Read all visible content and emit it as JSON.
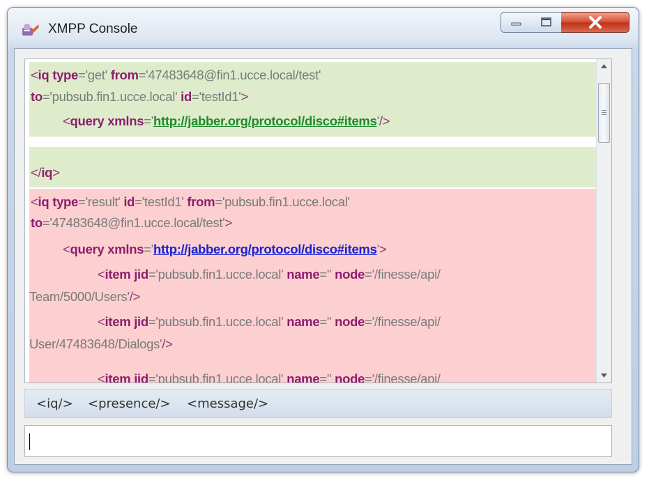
{
  "window": {
    "title": "XMPP Console",
    "app_icon": "xmpp-console-app-icon",
    "controls": {
      "minimize_icon": "minimize-icon",
      "maximize_icon": "maximize-icon",
      "close_icon": "close-icon"
    }
  },
  "colors": {
    "outgoing_bg": "#dfeccb",
    "incoming_bg": "#fcd0d0",
    "tag": "#8b1f6e",
    "attr_value": "#7a7a7a",
    "outgoing_link": "#1f8b2b",
    "incoming_link": "#1a22d6",
    "close_button": "#c0321b"
  },
  "console": {
    "sent": {
      "l1": {
        "lt": "<",
        "tag": "iq",
        "a1": "type",
        "v1": "'get'",
        "a2": "from",
        "v2": "'47483648@fin1.ucce.local/test'"
      },
      "l2": {
        "a1": "to",
        "v1": "'pubsub.fin1.ucce.local'",
        "a2": "id",
        "v2": "'testId1'",
        "gt": ">"
      },
      "l3": {
        "lt": "<",
        "tag": "query",
        "a1": "xmlns",
        "q1": "'",
        "link": "http://jabber.org/protocol/disco#items",
        "q2": "'",
        "end": "/>"
      },
      "l4": {
        "lt": "</",
        "tag": "iq",
        "gt": ">"
      }
    },
    "received": {
      "l1": {
        "lt": "<",
        "tag": "iq",
        "a1": "type",
        "v1": "'result'",
        "a2": "id",
        "v2": "'testId1'",
        "a3": "from",
        "v3": "'pubsub.fin1.ucce.local'"
      },
      "l2": {
        "a1": "to",
        "v1": "'47483648@fin1.ucce.local/test'",
        "gt": ">"
      },
      "l3": {
        "lt": "<",
        "tag": "query",
        "a1": "xmlns",
        "q1": "'",
        "link": "http://jabber.org/protocol/disco#items",
        "q2": "'",
        "gt": ">"
      },
      "item1": {
        "lt": "<",
        "tag": "item",
        "a1": "jid",
        "v1": "'pubsub.fin1.ucce.local'",
        "a2": "name",
        "v2": "''",
        "a3": "node",
        "v3": "'/finesse/api/",
        "cont": "Team/5000/Users'",
        "end": "/>"
      },
      "item2": {
        "lt": "<",
        "tag": "item",
        "a1": "jid",
        "v1": "'pubsub.fin1.ucce.local'",
        "a2": "name",
        "v2": "''",
        "a3": "node",
        "v3": "'/finesse/api/",
        "cont": "User/47483648/Dialogs'",
        "end": "/>"
      },
      "item3": {
        "lt": "<",
        "tag": "item",
        "a1": "jid",
        "v1": "'pubsub.fin1.ucce.local'",
        "a2": "name",
        "v2": "''",
        "a3": "node",
        "v3": "'/finesse/api/"
      }
    }
  },
  "quickbar": {
    "iq": "<iq/>",
    "presence": "<presence/>",
    "message": "<message/>"
  },
  "input": {
    "value": ""
  }
}
